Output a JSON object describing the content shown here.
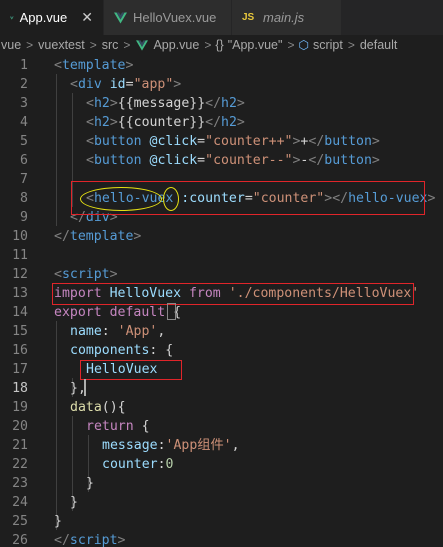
{
  "tabs": [
    {
      "label": "App.vue",
      "icon": "vue-icon",
      "active": true,
      "close": "✕"
    },
    {
      "label": "HelloVuex.vue",
      "icon": "vue-icon",
      "active": false
    },
    {
      "label": "main.js",
      "icon": "js-icon",
      "icon_text": "JS",
      "active": false
    }
  ],
  "breadcrumb": {
    "items": [
      "vue",
      "vuextest",
      "src",
      "App.vue",
      "\"App.vue\"",
      "script",
      "default"
    ],
    "separator": ">",
    "braces": "{}"
  },
  "editor": {
    "lines": [
      {
        "n": "1",
        "tokens": [
          [
            "t-br",
            "<"
          ],
          [
            "t-tag",
            "template"
          ],
          [
            "t-br",
            ">"
          ]
        ],
        "indent": 0
      },
      {
        "n": "2",
        "tokens": [
          [
            "t-br",
            "<"
          ],
          [
            "t-tag",
            "div "
          ],
          [
            "t-attr",
            "id"
          ],
          [
            "t-txt",
            "="
          ],
          [
            "t-str",
            "\"app\""
          ],
          [
            "t-br",
            ">"
          ]
        ],
        "indent": 1
      },
      {
        "n": "3",
        "tokens": [
          [
            "t-br",
            "<"
          ],
          [
            "t-tag",
            "h2"
          ],
          [
            "t-br",
            ">"
          ],
          [
            "t-txt",
            "{{message}}"
          ],
          [
            "t-br",
            "</"
          ],
          [
            "t-tag",
            "h2"
          ],
          [
            "t-br",
            ">"
          ]
        ],
        "indent": 2
      },
      {
        "n": "4",
        "tokens": [
          [
            "t-br",
            "<"
          ],
          [
            "t-tag",
            "h2"
          ],
          [
            "t-br",
            ">"
          ],
          [
            "t-txt",
            "{{counter}}"
          ],
          [
            "t-br",
            "</"
          ],
          [
            "t-tag",
            "h2"
          ],
          [
            "t-br",
            ">"
          ]
        ],
        "indent": 2
      },
      {
        "n": "5",
        "tokens": [
          [
            "t-br",
            "<"
          ],
          [
            "t-tag",
            "button "
          ],
          [
            "t-attr",
            "@click"
          ],
          [
            "t-txt",
            "="
          ],
          [
            "t-str",
            "\"counter++\""
          ],
          [
            "t-br",
            ">"
          ],
          [
            "t-txt",
            "+"
          ],
          [
            "t-br",
            "</"
          ],
          [
            "t-tag",
            "button"
          ],
          [
            "t-br",
            ">"
          ]
        ],
        "indent": 2
      },
      {
        "n": "6",
        "tokens": [
          [
            "t-br",
            "<"
          ],
          [
            "t-tag",
            "button "
          ],
          [
            "t-attr",
            "@click"
          ],
          [
            "t-txt",
            "="
          ],
          [
            "t-str",
            "\"counter--\""
          ],
          [
            "t-br",
            ">"
          ],
          [
            "t-txt",
            "-"
          ],
          [
            "t-br",
            "</"
          ],
          [
            "t-tag",
            "button"
          ],
          [
            "t-br",
            ">"
          ]
        ],
        "indent": 2
      },
      {
        "n": "7",
        "tokens": [],
        "indent": 2
      },
      {
        "n": "8",
        "tokens": [
          [
            "t-br",
            "<"
          ],
          [
            "t-tag",
            "hello-vuex "
          ],
          [
            "t-attr",
            ":counter"
          ],
          [
            "t-txt",
            "="
          ],
          [
            "t-str",
            "\"counter\""
          ],
          [
            "t-br",
            "></"
          ],
          [
            "t-tag",
            "hello-vuex"
          ],
          [
            "t-br",
            ">"
          ]
        ],
        "indent": 2
      },
      {
        "n": "9",
        "tokens": [
          [
            "t-br",
            "</"
          ],
          [
            "t-tag",
            "div"
          ],
          [
            "t-br",
            ">"
          ]
        ],
        "indent": 1
      },
      {
        "n": "10",
        "tokens": [
          [
            "t-br",
            "</"
          ],
          [
            "t-tag",
            "template"
          ],
          [
            "t-br",
            ">"
          ]
        ],
        "indent": 0
      },
      {
        "n": "11",
        "tokens": [],
        "indent": 0
      },
      {
        "n": "12",
        "tokens": [
          [
            "t-br",
            "<"
          ],
          [
            "t-tag",
            "script"
          ],
          [
            "t-br",
            ">"
          ]
        ],
        "indent": 0
      },
      {
        "n": "13",
        "tokens": [
          [
            "t-kw",
            "import "
          ],
          [
            "t-attr",
            "HelloVuex "
          ],
          [
            "t-kw",
            "from "
          ],
          [
            "t-str",
            "'./components/HelloVuex'"
          ]
        ],
        "indent": 0
      },
      {
        "n": "14",
        "tokens": [
          [
            "t-kw",
            "export default "
          ],
          [
            "t-txt",
            "{"
          ]
        ],
        "indent": 0
      },
      {
        "n": "15",
        "tokens": [
          [
            "t-attr",
            "name"
          ],
          [
            "t-txt",
            ": "
          ],
          [
            "t-str",
            "'App'"
          ],
          [
            "t-txt",
            ","
          ]
        ],
        "indent": 1
      },
      {
        "n": "16",
        "tokens": [
          [
            "t-attr",
            "components"
          ],
          [
            "t-txt",
            ": {"
          ]
        ],
        "indent": 1
      },
      {
        "n": "17",
        "tokens": [
          [
            "t-attr",
            "HelloVuex"
          ]
        ],
        "indent": 2
      },
      {
        "n": "18",
        "tokens": [
          [
            "t-txt",
            "},"
          ]
        ],
        "indent": 1
      },
      {
        "n": "19",
        "tokens": [
          [
            "t-fn",
            "data"
          ],
          [
            "t-txt",
            "(){"
          ]
        ],
        "indent": 1
      },
      {
        "n": "20",
        "tokens": [
          [
            "t-kw",
            "return "
          ],
          [
            "t-txt",
            "{"
          ]
        ],
        "indent": 2
      },
      {
        "n": "21",
        "tokens": [
          [
            "t-attr",
            "message"
          ],
          [
            "t-txt",
            ":"
          ],
          [
            "t-str",
            "'App组件'"
          ],
          [
            "t-txt",
            ","
          ]
        ],
        "indent": 3
      },
      {
        "n": "22",
        "tokens": [
          [
            "t-attr",
            "counter"
          ],
          [
            "t-txt",
            ":"
          ],
          [
            "t-num",
            "0"
          ]
        ],
        "indent": 3
      },
      {
        "n": "23",
        "tokens": [
          [
            "t-txt",
            "}"
          ]
        ],
        "indent": 2
      },
      {
        "n": "24",
        "tokens": [
          [
            "t-txt",
            "}"
          ]
        ],
        "indent": 1
      },
      {
        "n": "25",
        "tokens": [
          [
            "t-txt",
            "}"
          ]
        ],
        "indent": 0
      },
      {
        "n": "26",
        "tokens": [
          [
            "t-br",
            "</"
          ],
          [
            "t-tag",
            "script"
          ],
          [
            "t-br",
            ">"
          ]
        ],
        "indent": 0
      }
    ],
    "current_line": "18"
  },
  "colors": {
    "annotation_box": "#e0252a",
    "annotation_ellipse": "#e5e014",
    "vue_green": "#41b883",
    "js_yellow": "#e8c83c"
  }
}
